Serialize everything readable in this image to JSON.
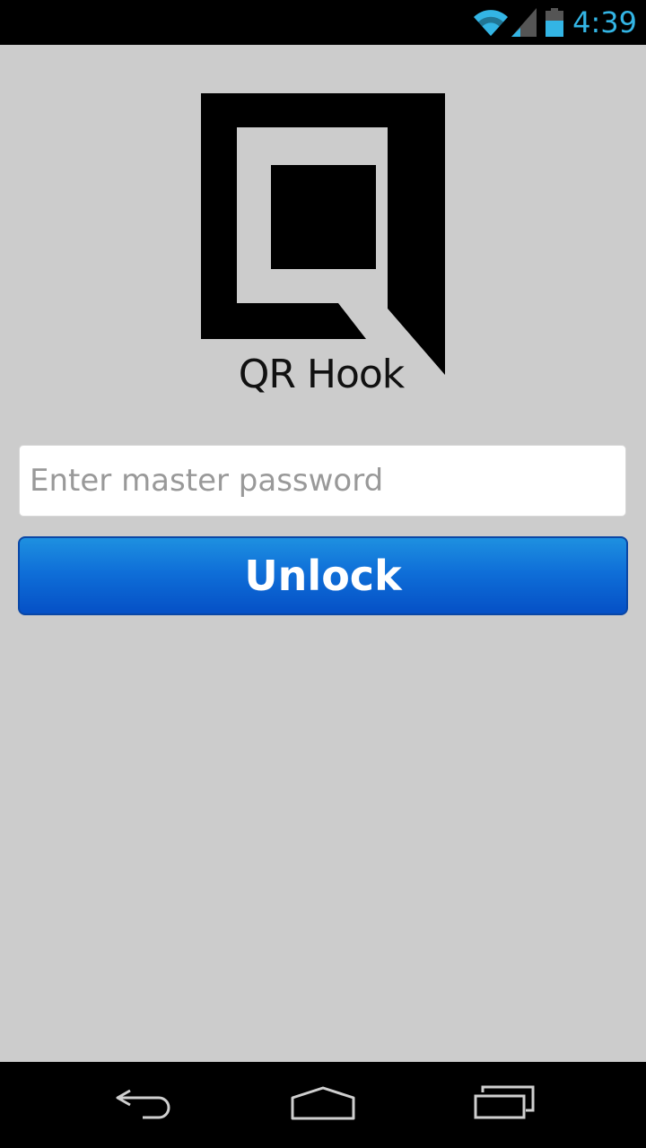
{
  "status_bar": {
    "time": "4:39",
    "icons": [
      "wifi-icon",
      "signal-icon",
      "battery-icon"
    ],
    "accent_color": "#33b5e5"
  },
  "app": {
    "name": "QR Hook",
    "logo_icon": "qr-hook-logo-icon"
  },
  "password": {
    "placeholder": "Enter master password",
    "value": ""
  },
  "unlock": {
    "label": "Unlock",
    "color": "#0f6fd8"
  },
  "nav_bar": {
    "icons": [
      "back-icon",
      "home-icon",
      "recent-apps-icon"
    ]
  }
}
